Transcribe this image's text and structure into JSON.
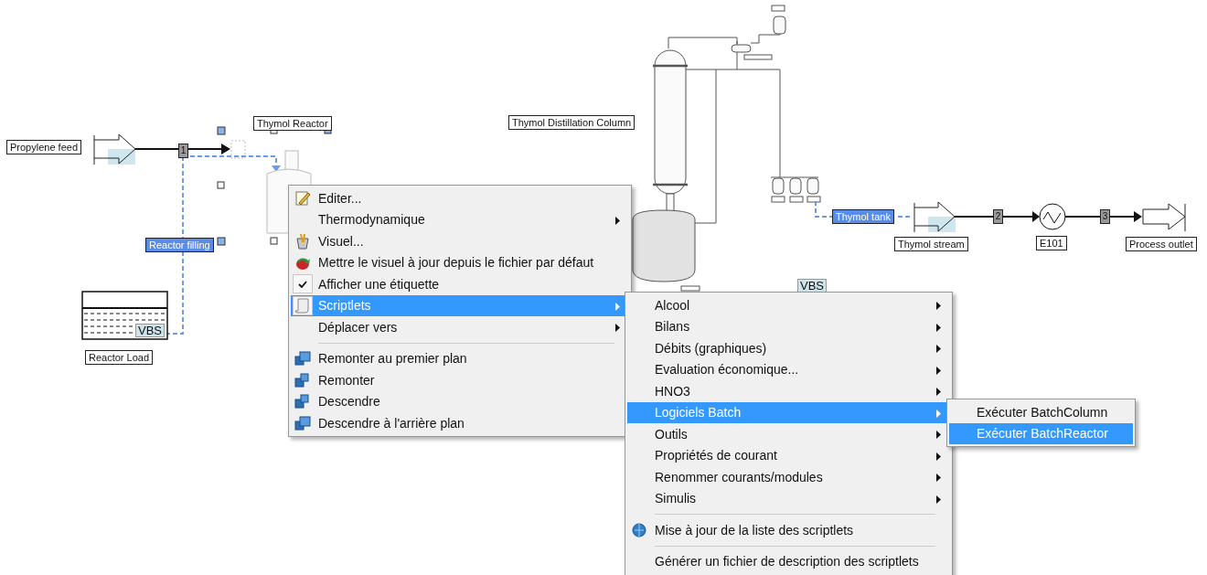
{
  "diagram": {
    "labels": [
      {
        "text": "Propylene feed",
        "selected": false
      },
      {
        "text": "Thymol Reactor",
        "selected": false
      },
      {
        "text": "Reactor filling",
        "selected": true
      },
      {
        "text": "VBS",
        "selected": false
      },
      {
        "text": "Reactor Load",
        "selected": false
      },
      {
        "text": "Thymol Distillation Column",
        "selected": false
      },
      {
        "text": "Thymol tank",
        "selected": true
      },
      {
        "text": "Thymol stream",
        "selected": false
      },
      {
        "text": "E101",
        "selected": false
      },
      {
        "text": "Process outlet",
        "selected": false
      },
      {
        "text": "VBS",
        "selected": false
      }
    ],
    "stream_numbers": [
      "1",
      "2",
      "3"
    ]
  },
  "context_menu": {
    "items": [
      {
        "label": "Editer...",
        "submenu": false,
        "checked": false,
        "selected": false
      },
      {
        "label": "Thermodynamique",
        "submenu": true,
        "checked": false,
        "selected": false
      },
      {
        "label": "Visuel...",
        "submenu": false,
        "checked": false,
        "selected": false
      },
      {
        "label": "Mettre le visuel à jour depuis le fichier par défaut",
        "submenu": false,
        "checked": false,
        "selected": false
      },
      {
        "label": "Afficher une étiquette",
        "submenu": false,
        "checked": true,
        "selected": false
      },
      {
        "label": "Scriptlets",
        "submenu": true,
        "checked": false,
        "selected": true
      },
      {
        "label": "Déplacer vers",
        "submenu": true,
        "checked": false,
        "selected": false,
        "separator_after": true
      },
      {
        "label": "Remonter au premier plan",
        "submenu": false,
        "checked": false,
        "selected": false
      },
      {
        "label": "Remonter",
        "submenu": false,
        "checked": false,
        "selected": false
      },
      {
        "label": "Descendre",
        "submenu": false,
        "checked": false,
        "selected": false
      },
      {
        "label": "Descendre à l'arrière plan",
        "submenu": false,
        "checked": false,
        "selected": false
      }
    ]
  },
  "scriptlets_menu": {
    "items": [
      {
        "label": "Alcool",
        "submenu": true,
        "selected": false
      },
      {
        "label": "Bilans",
        "submenu": true,
        "selected": false
      },
      {
        "label": "Débits (graphiques)",
        "submenu": true,
        "selected": false
      },
      {
        "label": "Evaluation économique...",
        "submenu": true,
        "selected": false
      },
      {
        "label": "HNO3",
        "submenu": true,
        "selected": false
      },
      {
        "label": "Logiciels Batch",
        "submenu": true,
        "selected": true
      },
      {
        "label": "Outils",
        "submenu": true,
        "selected": false
      },
      {
        "label": "Propriétés de courant",
        "submenu": true,
        "selected": false
      },
      {
        "label": "Renommer courants/modules",
        "submenu": true,
        "selected": false
      },
      {
        "label": "Simulis",
        "submenu": true,
        "selected": false,
        "separator_after": true
      },
      {
        "label": "Mise à jour de la liste des scriptlets",
        "submenu": false,
        "selected": false,
        "separator_after": true
      },
      {
        "label": "Générer un fichier de description des scriptlets",
        "submenu": false,
        "selected": false
      }
    ]
  },
  "batch_menu": {
    "items": [
      {
        "label": "Exécuter BatchColumn",
        "selected": false
      },
      {
        "label": "Exécuter BatchReactor",
        "selected": true
      }
    ]
  }
}
